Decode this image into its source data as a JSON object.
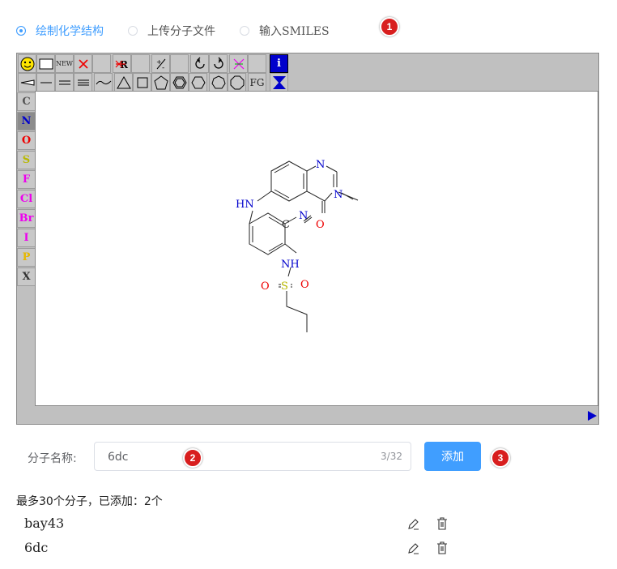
{
  "mode_options": [
    {
      "label": "绘制化学结构",
      "checked": true
    },
    {
      "label": "上传分子文件",
      "checked": false
    },
    {
      "label": "输入SMILES",
      "checked": false
    }
  ],
  "badges": [
    "1",
    "2",
    "3"
  ],
  "toolbar": {
    "row1": [
      "smiley-icon",
      "rectangle-icon",
      "NEW",
      "delete-x-icon",
      "",
      "remove-r-group-icon",
      "",
      "charge-icon",
      "",
      "rotate-left-icon",
      "rotate-right-icon",
      "query-icon",
      "",
      "info-icon"
    ],
    "new_label": "NEW",
    "fg_label": "FG",
    "info_label": "i"
  },
  "elements": [
    {
      "symbol": "C",
      "color": "#555555"
    },
    {
      "symbol": "N",
      "color": "#0000cc"
    },
    {
      "symbol": "O",
      "color": "#ee0000"
    },
    {
      "symbol": "S",
      "color": "#b8b800"
    },
    {
      "symbol": "F",
      "color": "#ee00ee"
    },
    {
      "symbol": "Cl",
      "color": "#ee00ee"
    },
    {
      "symbol": "Br",
      "color": "#ee00ee"
    },
    {
      "symbol": "I",
      "color": "#ee00ee"
    },
    {
      "symbol": "P",
      "color": "#e6b800"
    },
    {
      "symbol": "X",
      "color": "#333333"
    }
  ],
  "molecule_atoms": {
    "N_ring1": "N",
    "N_ring2": "N",
    "methyl_dash": "—",
    "O_carbonyl": "O",
    "HN": "HN",
    "C_nitrile": "C",
    "N_nitrile": "N",
    "NH": "NH",
    "S": "S",
    "O_left": "O",
    "O_right": "O"
  },
  "form": {
    "name_label": "分子名称:",
    "name_value": "6dc",
    "name_counter": "3/32",
    "add_button": "添加"
  },
  "summary": "最多30个分子，已添加：2个",
  "molecules": [
    {
      "name": "bay43"
    },
    {
      "name": "6dc"
    }
  ],
  "colors": {
    "accent": "#409eff",
    "badge": "#d81e1e"
  }
}
